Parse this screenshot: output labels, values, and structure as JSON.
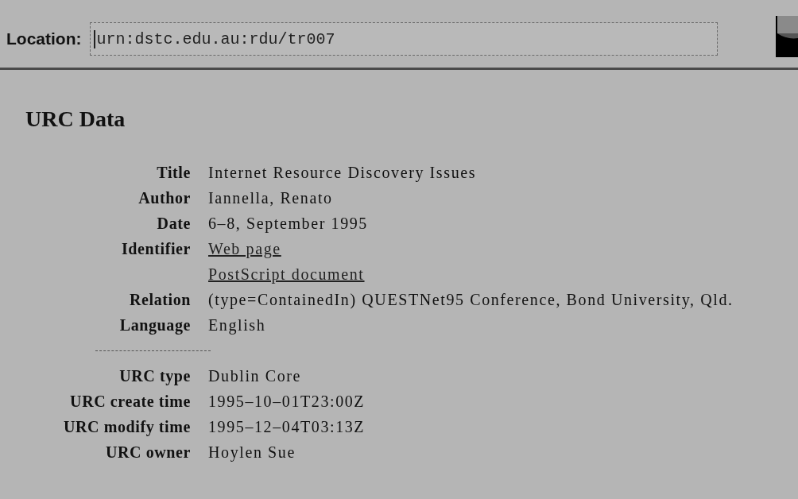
{
  "toolbar": {
    "location_label": "Location:",
    "location_value": "urn:dstc.edu.au:rdu/tr007"
  },
  "heading": "URC Data",
  "sections": [
    {
      "rows": [
        {
          "label": "Title",
          "value": "Internet Resource Discovery Issues",
          "kind": "text"
        },
        {
          "label": "Author",
          "value": "Iannella, Renato",
          "kind": "text"
        },
        {
          "label": "Date",
          "value": "6–8, September 1995",
          "kind": "text"
        },
        {
          "label": "Identifier",
          "value": "Web page",
          "kind": "link"
        },
        {
          "value": "PostScript document",
          "kind": "link"
        },
        {
          "label": "Relation",
          "value": "(type=ContainedIn) QUESTNet95 Conference, Bond University, Qld.",
          "kind": "text"
        },
        {
          "label": "Language",
          "value": "English",
          "kind": "text"
        }
      ]
    },
    {
      "rows": [
        {
          "label": "URC type",
          "value": "Dublin Core",
          "kind": "text"
        },
        {
          "label": "URC create time",
          "value": "1995–10–01T23:00Z",
          "kind": "text"
        },
        {
          "label": "URC modify time",
          "value": "1995–12–04T03:13Z",
          "kind": "text"
        },
        {
          "label": "URC owner",
          "value": "Hoylen Sue",
          "kind": "text"
        }
      ]
    }
  ]
}
